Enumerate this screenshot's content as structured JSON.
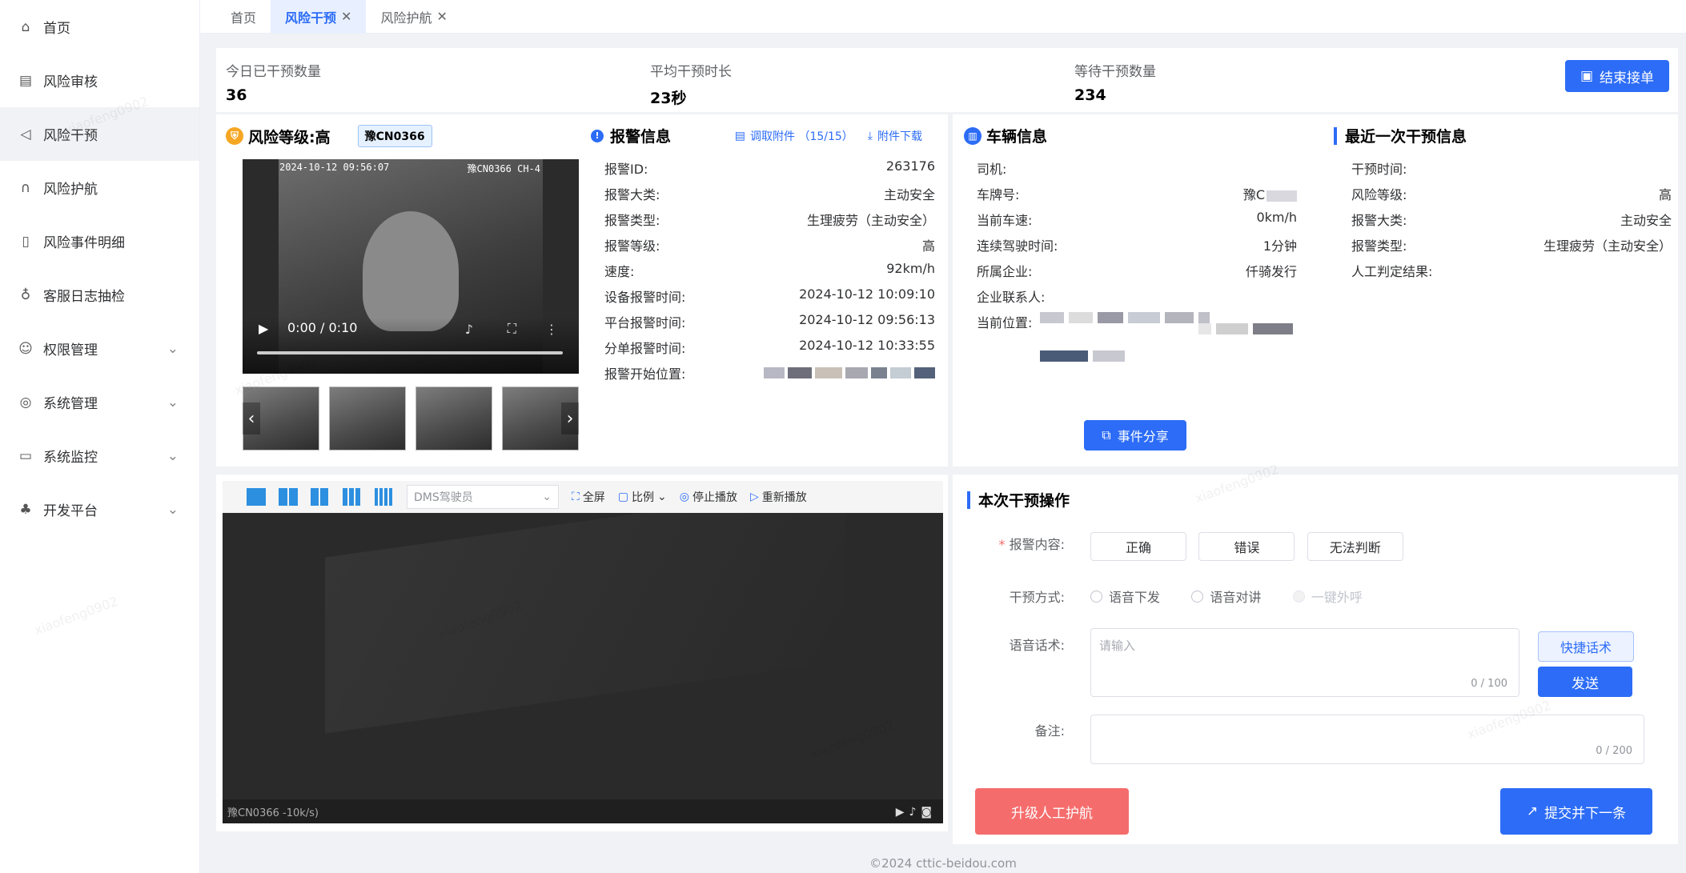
{
  "sidebar": {
    "items": [
      {
        "label": "首页",
        "icon": "home-icon"
      },
      {
        "label": "风险审核",
        "icon": "audit-icon"
      },
      {
        "label": "风险干预",
        "icon": "speaker-icon"
      },
      {
        "label": "风险护航",
        "icon": "headset-icon"
      },
      {
        "label": "风险事件明细",
        "icon": "document-icon"
      },
      {
        "label": "客服日志抽检",
        "icon": "pin-icon"
      },
      {
        "label": "权限管理",
        "icon": "user-icon"
      },
      {
        "label": "系统管理",
        "icon": "settings-icon"
      },
      {
        "label": "系统监控",
        "icon": "monitor-icon"
      },
      {
        "label": "开发平台",
        "icon": "network-icon"
      }
    ]
  },
  "tabs": [
    {
      "label": "首页"
    },
    {
      "label": "风险干预"
    },
    {
      "label": "风险护航"
    }
  ],
  "stats": {
    "today_label": "今日已干预数量",
    "today_value": "36",
    "avg_label": "平均干预时长",
    "avg_value": "23秒",
    "waiting_label": "等待干预数量",
    "waiting_value": "234",
    "end_button": "结束接单"
  },
  "risk": {
    "title": "风险等级:高",
    "plate": "豫CN0366",
    "video_timestamp": "2024-10-12 09:56:07",
    "video_channel": "豫CN0366 CH-4",
    "video_time": "0:00 / 0:10"
  },
  "alarm": {
    "title": "报警信息",
    "fetch_link": "调取附件 （15/15）",
    "download_link": "附件下载",
    "rows": [
      {
        "label": "报警ID:",
        "value": "263176"
      },
      {
        "label": "报警大类:",
        "value": "主动安全"
      },
      {
        "label": "报警类型:",
        "value": "生理疲劳（主动安全）"
      },
      {
        "label": "报警等级:",
        "value": "高"
      },
      {
        "label": "速度:",
        "value": "92km/h"
      },
      {
        "label": "设备报警时间:",
        "value": "2024-10-12 10:09:10"
      },
      {
        "label": "平台报警时间:",
        "value": "2024-10-12 09:56:13"
      },
      {
        "label": "分单报警时间:",
        "value": "2024-10-12 10:33:55"
      },
      {
        "label": "报警开始位置:",
        "value": ""
      }
    ]
  },
  "vehicle": {
    "title": "车辆信息",
    "rows": [
      {
        "label": "司机:",
        "value": ""
      },
      {
        "label": "车牌号:",
        "value": "豫C"
      },
      {
        "label": "当前车速:",
        "value": "0km/h"
      },
      {
        "label": "连续驾驶时间:",
        "value": "1分钟"
      },
      {
        "label": "所属企业:",
        "value": "仟骑发行"
      },
      {
        "label": "企业联系人:",
        "value": ""
      },
      {
        "label": "当前位置:",
        "value": ""
      }
    ],
    "share_button": "事件分享"
  },
  "last": {
    "title": "最近一次干预信息",
    "rows": [
      {
        "label": "干预时间:",
        "value": ""
      },
      {
        "label": "风险等级:",
        "value": "高"
      },
      {
        "label": "报警大类:",
        "value": "主动安全"
      },
      {
        "label": "报警类型:",
        "value": "生理疲劳（主动安全）"
      },
      {
        "label": "人工判定结果:",
        "value": ""
      }
    ]
  },
  "monitor": {
    "select_value": "DMS驾驶员",
    "fullscreen": "全屏",
    "ratio": "比例",
    "stop": "停止播放",
    "replay": "重新播放",
    "footer_text": "豫CN0366 -10k/s)"
  },
  "intervene": {
    "title": "本次干预操作",
    "content_label": "报警内容:",
    "content_options": [
      "正确",
      "错误",
      "无法判断"
    ],
    "method_label": "干预方式:",
    "methods": [
      "语音下发",
      "语音对讲",
      "一键外呼"
    ],
    "speech_label": "语音话术:",
    "speech_placeholder": "请输入",
    "speech_counter": "0 / 100",
    "quick_button": "快捷话术",
    "send_button": "发送",
    "remark_label": "备注:",
    "remark_counter": "0 / 200",
    "upgrade_button": "升级人工护航",
    "submit_button": "提交并下一条"
  },
  "watermark": "xiaofeng0902",
  "footer": "©2024 cttic-beidou.com",
  "colors": {
    "primary": "#2c6cf6",
    "danger": "#f56c6c",
    "sidebar_active": "#f0f2f5"
  }
}
